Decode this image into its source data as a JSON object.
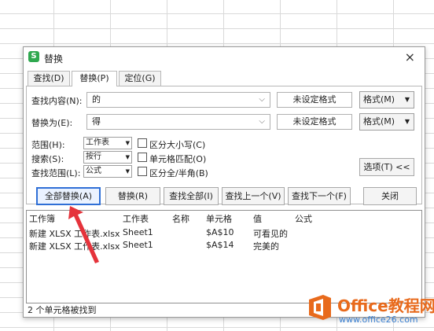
{
  "dialog": {
    "title": "替换",
    "app_icon_glyph": "S",
    "close_glyph": "×",
    "tabs": [
      {
        "label": "查找(D)"
      },
      {
        "label": "替换(P)",
        "active": true
      },
      {
        "label": "定位(G)"
      }
    ],
    "find": {
      "label": "查找内容(N):",
      "value": "的",
      "format_status": "未设定格式",
      "format_button": "格式(M)"
    },
    "replace": {
      "label": "替换为(E):",
      "value": "得",
      "format_status": "未设定格式",
      "format_button": "格式(M)"
    },
    "options": {
      "scope_label": "范围(H):",
      "scope_value": "工作表",
      "search_label": "搜索(S):",
      "search_value": "按行",
      "lookin_label": "查找范围(L):",
      "lookin_value": "公式",
      "match_case": "区分大小写(C)",
      "match_cell": "单元格匹配(O)",
      "match_width": "区分全/半角(B)",
      "options_button": "选项(T) <<"
    },
    "actions": {
      "replace_all": "全部替换(A)",
      "replace": "替换(R)",
      "find_all": "查找全部(I)",
      "find_prev": "查找上一个(V)",
      "find_next": "查找下一个(F)",
      "close": "关闭"
    },
    "results": {
      "columns": [
        "工作簿",
        "工作表",
        "名称",
        "单元格",
        "值",
        "公式"
      ],
      "rows": [
        {
          "workbook": "新建 XLSX 工作表.xlsx",
          "sheet": "Sheet1",
          "name": "",
          "cell": "$A$10",
          "value": "可看见的",
          "formula": ""
        },
        {
          "workbook": "新建 XLSX 工作表.xlsx",
          "sheet": "Sheet1",
          "name": "",
          "cell": "$A$14",
          "value": "完美的",
          "formula": ""
        }
      ]
    },
    "status": "2 个单元格被找到"
  },
  "watermark": {
    "title": "Office教程网",
    "url": "www.office26.com"
  },
  "colors": {
    "accent_border": "#2f6fd6",
    "annotation_arrow": "#e5333b",
    "watermark_orange": "#e86a1c"
  }
}
